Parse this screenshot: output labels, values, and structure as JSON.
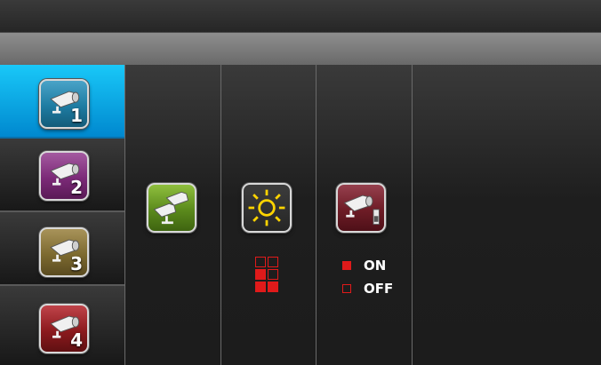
{
  "cameras": [
    {
      "number": "1",
      "color": "#1e7ca2",
      "active": true
    },
    {
      "number": "2",
      "color": "#7c2a78",
      "active": false
    },
    {
      "number": "3",
      "color": "#7d6a30",
      "active": false
    },
    {
      "number": "4",
      "color": "#8c1a1e",
      "active": false
    }
  ],
  "tools": {
    "pairing_color": "#5b8a1c",
    "brightness_color": "#2a2a2a",
    "brightness_sun_color": "#ffd400",
    "record_color": "#6e1c26"
  },
  "brightness_level": {
    "filled": 3,
    "total": 6
  },
  "record_options": [
    {
      "label": "ON",
      "selected": true
    },
    {
      "label": "OFF",
      "selected": false
    }
  ],
  "accent_red": "#e01a1a",
  "active_tab_color": "#0aa0e4"
}
